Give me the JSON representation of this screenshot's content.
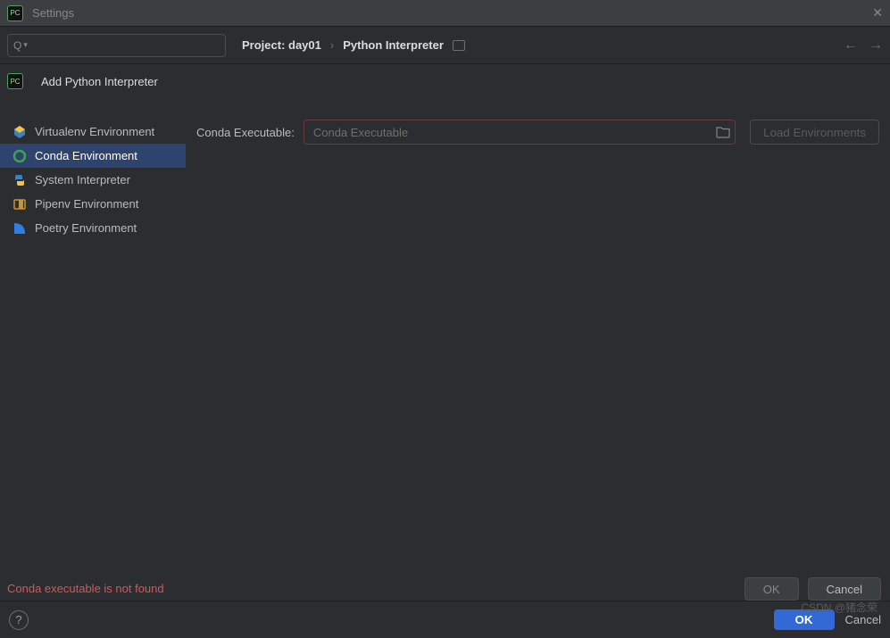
{
  "title": "Settings",
  "app_badge": "PC",
  "search": {
    "glyph": "Q",
    "placeholder": ""
  },
  "breadcrumb": {
    "project": "Project: day01",
    "sep": "›",
    "page": "Python Interpreter"
  },
  "nav": {
    "back": "←",
    "fwd": "→"
  },
  "modal": {
    "title": "Add Python Interpreter",
    "sidebar": [
      {
        "label": "Virtualenv Environment"
      },
      {
        "label": "Conda Environment"
      },
      {
        "label": "System Interpreter"
      },
      {
        "label": "Pipenv Environment"
      },
      {
        "label": "Poetry Environment"
      }
    ],
    "form": {
      "label": "Conda Executable:",
      "placeholder": "Conda Executable",
      "load_btn": "Load Environments"
    },
    "error": "Conda executable is not found",
    "ok": "OK",
    "cancel": "Cancel"
  },
  "bottom": {
    "help": "?",
    "ok": "OK",
    "cancel": "Cancel"
  },
  "watermark": "CSDN @猪念荣"
}
